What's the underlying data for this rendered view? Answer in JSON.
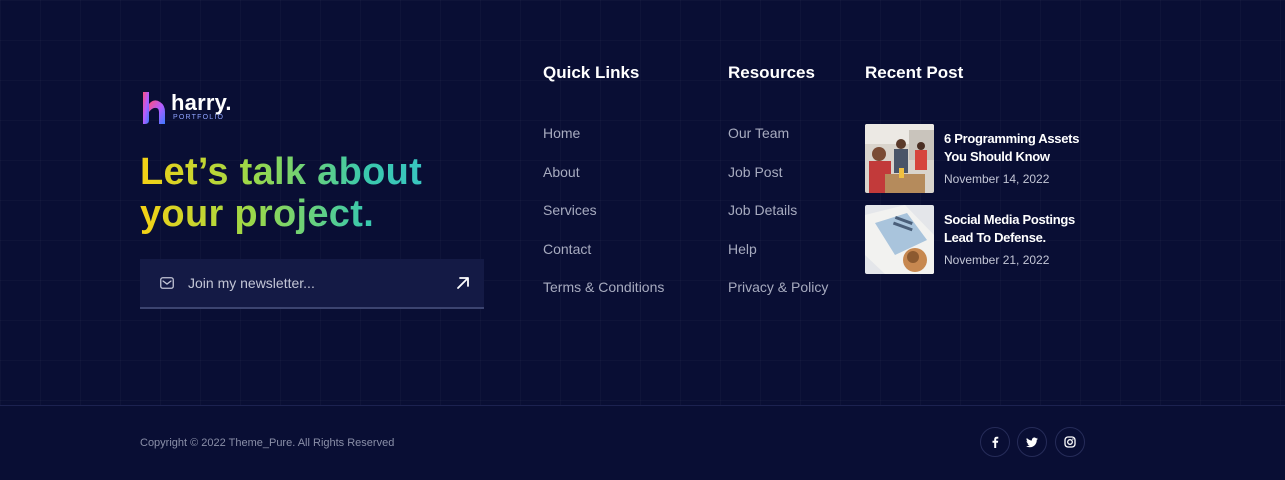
{
  "brand": {
    "name": "harry.",
    "subtitle": "PORTFOLIO"
  },
  "headline": {
    "line1": "Let’s talk about",
    "line2": "your project."
  },
  "newsletter": {
    "placeholder": "Join my newsletter..."
  },
  "quick_links": {
    "title": "Quick Links",
    "items": [
      "Home",
      "About",
      "Services",
      "Contact",
      "Terms & Conditions"
    ]
  },
  "resources": {
    "title": "Resources",
    "items": [
      "Our Team",
      "Job Post",
      "Job Details",
      "Help",
      "Privacy & Policy"
    ]
  },
  "recent_post": {
    "title": "Recent Post",
    "posts": [
      {
        "title": "6 Programming Assets You Should Know",
        "date": "November 14, 2022"
      },
      {
        "title": "Social Media Postings Lead To Defense.",
        "date": "November 21, 2022"
      }
    ]
  },
  "footer": {
    "copyright": "Copyright © 2022 Theme_Pure. All Rights Reserved",
    "social": [
      "facebook-icon",
      "twitter-icon",
      "instagram-icon"
    ]
  },
  "colors": {
    "background": "#090e34",
    "headline_start": "#f5d114",
    "headline_end": "#39c5c0"
  }
}
